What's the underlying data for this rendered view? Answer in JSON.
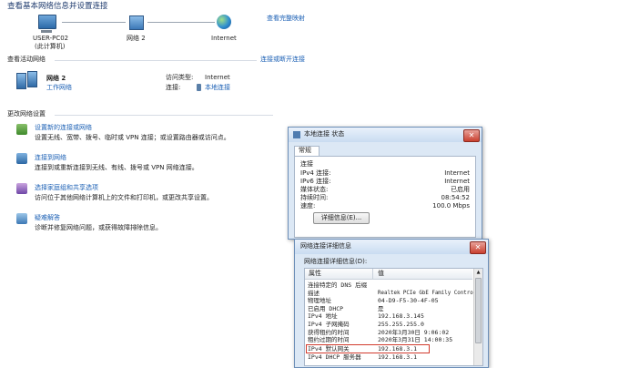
{
  "main": {
    "title": "查看基本网络信息并设置连接",
    "full_map_link": "查看完整映射",
    "map": {
      "computer_name": "USER-PC02",
      "computer_sub": "(此计算机)",
      "network_name": "网络 2",
      "internet_label": "Internet"
    },
    "active_networks": {
      "header": "查看活动网络",
      "connect_link": "连接或断开连接",
      "network_name": "网络 2",
      "network_type_link": "工作网络",
      "access_type_label": "访问类型:",
      "access_type_value": "Internet",
      "connections_label": "连接:",
      "connections_value": "本地连接"
    },
    "change_settings": {
      "header": "更改网络设置",
      "tasks": [
        {
          "title": "设置新的连接或网络",
          "desc": "设置无线、宽带、拨号、临时或 VPN 连接；或设置路由器或访问点。"
        },
        {
          "title": "连接到网络",
          "desc": "连接到或重新连接到无线、有线、拨号或 VPN 网络连接。"
        },
        {
          "title": "选择家庭组和共享选项",
          "desc": "访问位于其他网络计算机上的文件和打印机，或更改共享设置。"
        },
        {
          "title": "疑难解答",
          "desc": "诊断并修复网络问题，或获得故障排除信息。"
        }
      ]
    }
  },
  "status_dialog": {
    "title": "本地连接 状态",
    "tab": "常规",
    "group": "连接",
    "rows": [
      {
        "label": "IPv4 连接:",
        "value": "Internet"
      },
      {
        "label": "IPv6 连接:",
        "value": "Internet"
      },
      {
        "label": "媒体状态:",
        "value": "已启用"
      },
      {
        "label": "持续时间:",
        "value": "08:54:52"
      },
      {
        "label": "速度:",
        "value": "100.0 Mbps"
      }
    ],
    "details_button": "详细信息(E)..."
  },
  "details_dialog": {
    "title": "网络连接详细信息",
    "caption": "网络连接详细信息(D):",
    "col_property": "属性",
    "col_value": "值",
    "rows": [
      {
        "property": "连接特定的 DNS 后缀",
        "value": ""
      },
      {
        "property": "描述",
        "value": "Realtek PCIe GbE Family Contro"
      },
      {
        "property": "物理地址",
        "value": "04-D9-F5-30-4F-05"
      },
      {
        "property": "已启用 DHCP",
        "value": "是"
      },
      {
        "property": "IPv4 地址",
        "value": "192.168.3.145"
      },
      {
        "property": "IPv4 子网掩码",
        "value": "255.255.255.0"
      },
      {
        "property": "获得租约的时间",
        "value": "2020年3月30日 9:06:02"
      },
      {
        "property": "租约过期的时间",
        "value": "2020年3月31日 14:00:35"
      },
      {
        "property": "IPv4 默认网关",
        "value": "192.168.3.1"
      },
      {
        "property": "IPv4 DHCP 服务器",
        "value": "192.168.3.1"
      }
    ]
  },
  "colors": {
    "link": "#1a5fb4",
    "highlight": "#d23b2e",
    "dialog_frame": "#6d8fb8"
  }
}
